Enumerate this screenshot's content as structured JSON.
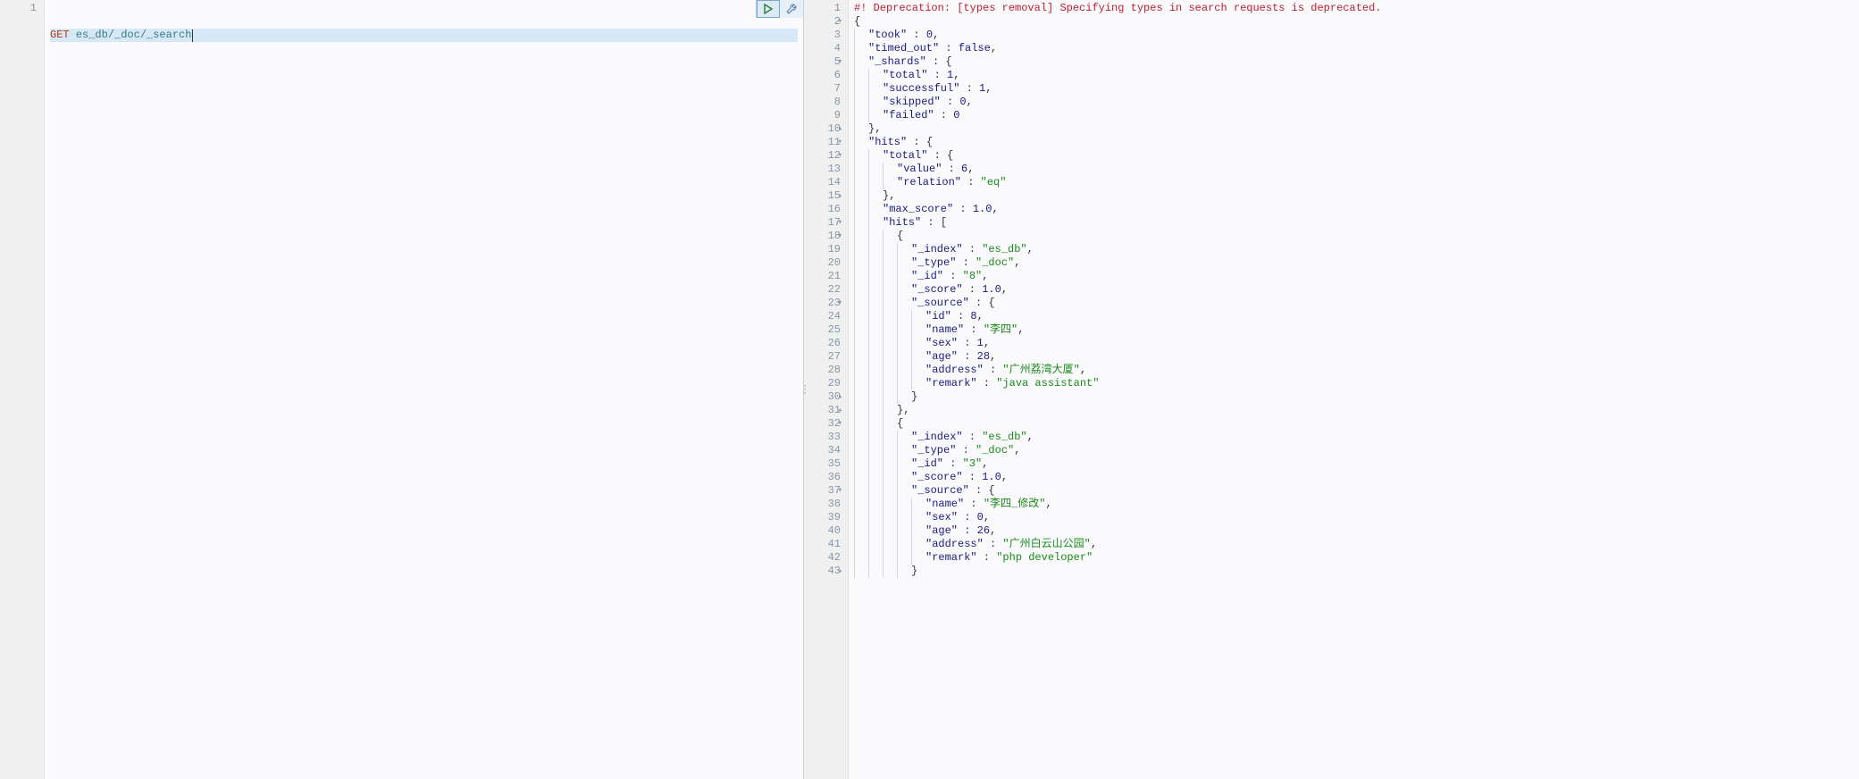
{
  "request": {
    "gutter": [
      "1"
    ],
    "method": "GET",
    "path": "es_db/_doc/_search"
  },
  "actions": {
    "play_title": "Click to send request",
    "wrench_title": "Open documentation"
  },
  "response": {
    "lines": [
      {
        "n": "1",
        "fold": "",
        "ind": 0,
        "guides": 0,
        "tokens": [
          {
            "t": "#! Deprecation: [types removal] Specifying types in search requests is deprecated.",
            "c": "warn"
          }
        ]
      },
      {
        "n": "2",
        "fold": "▾",
        "ind": 0,
        "guides": 0,
        "tokens": [
          {
            "t": "{",
            "c": "pun"
          }
        ]
      },
      {
        "n": "3",
        "fold": "",
        "ind": 1,
        "guides": 1,
        "tokens": [
          {
            "t": "\"took\"",
            "c": "key"
          },
          {
            "t": " : ",
            "c": "pun"
          },
          {
            "t": "0",
            "c": "num"
          },
          {
            "t": ",",
            "c": "pun"
          }
        ]
      },
      {
        "n": "4",
        "fold": "",
        "ind": 1,
        "guides": 1,
        "tokens": [
          {
            "t": "\"timed_out\"",
            "c": "key"
          },
          {
            "t": " : ",
            "c": "pun"
          },
          {
            "t": "false",
            "c": "bool"
          },
          {
            "t": ",",
            "c": "pun"
          }
        ]
      },
      {
        "n": "5",
        "fold": "▾",
        "ind": 1,
        "guides": 1,
        "tokens": [
          {
            "t": "\"_shards\"",
            "c": "key"
          },
          {
            "t": " : {",
            "c": "pun"
          }
        ]
      },
      {
        "n": "6",
        "fold": "",
        "ind": 2,
        "guides": 2,
        "tokens": [
          {
            "t": "\"total\"",
            "c": "key"
          },
          {
            "t": " : ",
            "c": "pun"
          },
          {
            "t": "1",
            "c": "num"
          },
          {
            "t": ",",
            "c": "pun"
          }
        ]
      },
      {
        "n": "7",
        "fold": "",
        "ind": 2,
        "guides": 2,
        "tokens": [
          {
            "t": "\"successful\"",
            "c": "key"
          },
          {
            "t": " : ",
            "c": "pun"
          },
          {
            "t": "1",
            "c": "num"
          },
          {
            "t": ",",
            "c": "pun"
          }
        ]
      },
      {
        "n": "8",
        "fold": "",
        "ind": 2,
        "guides": 2,
        "tokens": [
          {
            "t": "\"skipped\"",
            "c": "key"
          },
          {
            "t": " : ",
            "c": "pun"
          },
          {
            "t": "0",
            "c": "num"
          },
          {
            "t": ",",
            "c": "pun"
          }
        ]
      },
      {
        "n": "9",
        "fold": "",
        "ind": 2,
        "guides": 2,
        "tokens": [
          {
            "t": "\"failed\"",
            "c": "key"
          },
          {
            "t": " : ",
            "c": "pun"
          },
          {
            "t": "0",
            "c": "num"
          }
        ]
      },
      {
        "n": "10",
        "fold": "▴",
        "ind": 1,
        "guides": 1,
        "tokens": [
          {
            "t": "},",
            "c": "pun"
          }
        ]
      },
      {
        "n": "11",
        "fold": "▾",
        "ind": 1,
        "guides": 1,
        "tokens": [
          {
            "t": "\"hits\"",
            "c": "key"
          },
          {
            "t": " : {",
            "c": "pun"
          }
        ]
      },
      {
        "n": "12",
        "fold": "▾",
        "ind": 2,
        "guides": 2,
        "tokens": [
          {
            "t": "\"total\"",
            "c": "key"
          },
          {
            "t": " : {",
            "c": "pun"
          }
        ]
      },
      {
        "n": "13",
        "fold": "",
        "ind": 3,
        "guides": 3,
        "tokens": [
          {
            "t": "\"value\"",
            "c": "key"
          },
          {
            "t": " : ",
            "c": "pun"
          },
          {
            "t": "6",
            "c": "num"
          },
          {
            "t": ",",
            "c": "pun"
          }
        ]
      },
      {
        "n": "14",
        "fold": "",
        "ind": 3,
        "guides": 3,
        "tokens": [
          {
            "t": "\"relation\"",
            "c": "key"
          },
          {
            "t": " : ",
            "c": "pun"
          },
          {
            "t": "\"eq\"",
            "c": "str"
          }
        ]
      },
      {
        "n": "15",
        "fold": "▴",
        "ind": 2,
        "guides": 2,
        "tokens": [
          {
            "t": "},",
            "c": "pun"
          }
        ]
      },
      {
        "n": "16",
        "fold": "",
        "ind": 2,
        "guides": 2,
        "tokens": [
          {
            "t": "\"max_score\"",
            "c": "key"
          },
          {
            "t": " : ",
            "c": "pun"
          },
          {
            "t": "1.0",
            "c": "num"
          },
          {
            "t": ",",
            "c": "pun"
          }
        ]
      },
      {
        "n": "17",
        "fold": "▾",
        "ind": 2,
        "guides": 2,
        "tokens": [
          {
            "t": "\"hits\"",
            "c": "key"
          },
          {
            "t": " : [",
            "c": "pun"
          }
        ]
      },
      {
        "n": "18",
        "fold": "▾",
        "ind": 3,
        "guides": 3,
        "tokens": [
          {
            "t": "{",
            "c": "pun"
          }
        ]
      },
      {
        "n": "19",
        "fold": "",
        "ind": 4,
        "guides": 4,
        "tokens": [
          {
            "t": "\"_index\"",
            "c": "key"
          },
          {
            "t": " : ",
            "c": "pun"
          },
          {
            "t": "\"es_db\"",
            "c": "str"
          },
          {
            "t": ",",
            "c": "pun"
          }
        ]
      },
      {
        "n": "20",
        "fold": "",
        "ind": 4,
        "guides": 4,
        "tokens": [
          {
            "t": "\"_type\"",
            "c": "key"
          },
          {
            "t": " : ",
            "c": "pun"
          },
          {
            "t": "\"_doc\"",
            "c": "str"
          },
          {
            "t": ",",
            "c": "pun"
          }
        ]
      },
      {
        "n": "21",
        "fold": "",
        "ind": 4,
        "guides": 4,
        "tokens": [
          {
            "t": "\"_id\"",
            "c": "key"
          },
          {
            "t": " : ",
            "c": "pun"
          },
          {
            "t": "\"8\"",
            "c": "str"
          },
          {
            "t": ",",
            "c": "pun"
          }
        ]
      },
      {
        "n": "22",
        "fold": "",
        "ind": 4,
        "guides": 4,
        "tokens": [
          {
            "t": "\"_score\"",
            "c": "key"
          },
          {
            "t": " : ",
            "c": "pun"
          },
          {
            "t": "1.0",
            "c": "num"
          },
          {
            "t": ",",
            "c": "pun"
          }
        ]
      },
      {
        "n": "23",
        "fold": "▾",
        "ind": 4,
        "guides": 4,
        "tokens": [
          {
            "t": "\"_source\"",
            "c": "key"
          },
          {
            "t": " : {",
            "c": "pun"
          }
        ]
      },
      {
        "n": "24",
        "fold": "",
        "ind": 5,
        "guides": 5,
        "tokens": [
          {
            "t": "\"id\"",
            "c": "key"
          },
          {
            "t": " : ",
            "c": "pun"
          },
          {
            "t": "8",
            "c": "num"
          },
          {
            "t": ",",
            "c": "pun"
          }
        ]
      },
      {
        "n": "25",
        "fold": "",
        "ind": 5,
        "guides": 5,
        "tokens": [
          {
            "t": "\"name\"",
            "c": "key"
          },
          {
            "t": " : ",
            "c": "pun"
          },
          {
            "t": "\"李四\"",
            "c": "str"
          },
          {
            "t": ",",
            "c": "pun"
          }
        ]
      },
      {
        "n": "26",
        "fold": "",
        "ind": 5,
        "guides": 5,
        "tokens": [
          {
            "t": "\"sex\"",
            "c": "key"
          },
          {
            "t": " : ",
            "c": "pun"
          },
          {
            "t": "1",
            "c": "num"
          },
          {
            "t": ",",
            "c": "pun"
          }
        ]
      },
      {
        "n": "27",
        "fold": "",
        "ind": 5,
        "guides": 5,
        "tokens": [
          {
            "t": "\"age\"",
            "c": "key"
          },
          {
            "t": " : ",
            "c": "pun"
          },
          {
            "t": "28",
            "c": "num"
          },
          {
            "t": ",",
            "c": "pun"
          }
        ]
      },
      {
        "n": "28",
        "fold": "",
        "ind": 5,
        "guides": 5,
        "tokens": [
          {
            "t": "\"address\"",
            "c": "key"
          },
          {
            "t": " : ",
            "c": "pun"
          },
          {
            "t": "\"广州荔湾大厦\"",
            "c": "str"
          },
          {
            "t": ",",
            "c": "pun"
          }
        ]
      },
      {
        "n": "29",
        "fold": "",
        "ind": 5,
        "guides": 5,
        "tokens": [
          {
            "t": "\"remark\"",
            "c": "key"
          },
          {
            "t": " : ",
            "c": "pun"
          },
          {
            "t": "\"java assistant\"",
            "c": "str"
          }
        ]
      },
      {
        "n": "30",
        "fold": "▴",
        "ind": 4,
        "guides": 4,
        "tokens": [
          {
            "t": "}",
            "c": "pun"
          }
        ]
      },
      {
        "n": "31",
        "fold": "▴",
        "ind": 3,
        "guides": 3,
        "tokens": [
          {
            "t": "},",
            "c": "pun"
          }
        ]
      },
      {
        "n": "32",
        "fold": "▾",
        "ind": 3,
        "guides": 3,
        "tokens": [
          {
            "t": "{",
            "c": "pun"
          }
        ]
      },
      {
        "n": "33",
        "fold": "",
        "ind": 4,
        "guides": 4,
        "tokens": [
          {
            "t": "\"_index\"",
            "c": "key"
          },
          {
            "t": " : ",
            "c": "pun"
          },
          {
            "t": "\"es_db\"",
            "c": "str"
          },
          {
            "t": ",",
            "c": "pun"
          }
        ]
      },
      {
        "n": "34",
        "fold": "",
        "ind": 4,
        "guides": 4,
        "tokens": [
          {
            "t": "\"_type\"",
            "c": "key"
          },
          {
            "t": " : ",
            "c": "pun"
          },
          {
            "t": "\"_doc\"",
            "c": "str"
          },
          {
            "t": ",",
            "c": "pun"
          }
        ]
      },
      {
        "n": "35",
        "fold": "",
        "ind": 4,
        "guides": 4,
        "tokens": [
          {
            "t": "\"_id\"",
            "c": "key"
          },
          {
            "t": " : ",
            "c": "pun"
          },
          {
            "t": "\"3\"",
            "c": "str"
          },
          {
            "t": ",",
            "c": "pun"
          }
        ]
      },
      {
        "n": "36",
        "fold": "",
        "ind": 4,
        "guides": 4,
        "tokens": [
          {
            "t": "\"_score\"",
            "c": "key"
          },
          {
            "t": " : ",
            "c": "pun"
          },
          {
            "t": "1.0",
            "c": "num"
          },
          {
            "t": ",",
            "c": "pun"
          }
        ]
      },
      {
        "n": "37",
        "fold": "▾",
        "ind": 4,
        "guides": 4,
        "tokens": [
          {
            "t": "\"_source\"",
            "c": "key"
          },
          {
            "t": " : {",
            "c": "pun"
          }
        ]
      },
      {
        "n": "38",
        "fold": "",
        "ind": 5,
        "guides": 5,
        "tokens": [
          {
            "t": "\"name\"",
            "c": "key"
          },
          {
            "t": " : ",
            "c": "pun"
          },
          {
            "t": "\"李四_修改\"",
            "c": "str"
          },
          {
            "t": ",",
            "c": "pun"
          }
        ]
      },
      {
        "n": "39",
        "fold": "",
        "ind": 5,
        "guides": 5,
        "tokens": [
          {
            "t": "\"sex\"",
            "c": "key"
          },
          {
            "t": " : ",
            "c": "pun"
          },
          {
            "t": "0",
            "c": "num"
          },
          {
            "t": ",",
            "c": "pun"
          }
        ]
      },
      {
        "n": "40",
        "fold": "",
        "ind": 5,
        "guides": 5,
        "tokens": [
          {
            "t": "\"age\"",
            "c": "key"
          },
          {
            "t": " : ",
            "c": "pun"
          },
          {
            "t": "26",
            "c": "num"
          },
          {
            "t": ",",
            "c": "pun"
          }
        ]
      },
      {
        "n": "41",
        "fold": "",
        "ind": 5,
        "guides": 5,
        "tokens": [
          {
            "t": "\"address\"",
            "c": "key"
          },
          {
            "t": " : ",
            "c": "pun"
          },
          {
            "t": "\"广州白云山公园\"",
            "c": "str"
          },
          {
            "t": ",",
            "c": "pun"
          }
        ]
      },
      {
        "n": "42",
        "fold": "",
        "ind": 5,
        "guides": 5,
        "tokens": [
          {
            "t": "\"remark\"",
            "c": "key"
          },
          {
            "t": " : ",
            "c": "pun"
          },
          {
            "t": "\"php developer\"",
            "c": "str"
          }
        ]
      },
      {
        "n": "43",
        "fold": "▴",
        "ind": 4,
        "guides": 4,
        "tokens": [
          {
            "t": "}",
            "c": "pun"
          }
        ]
      }
    ]
  }
}
